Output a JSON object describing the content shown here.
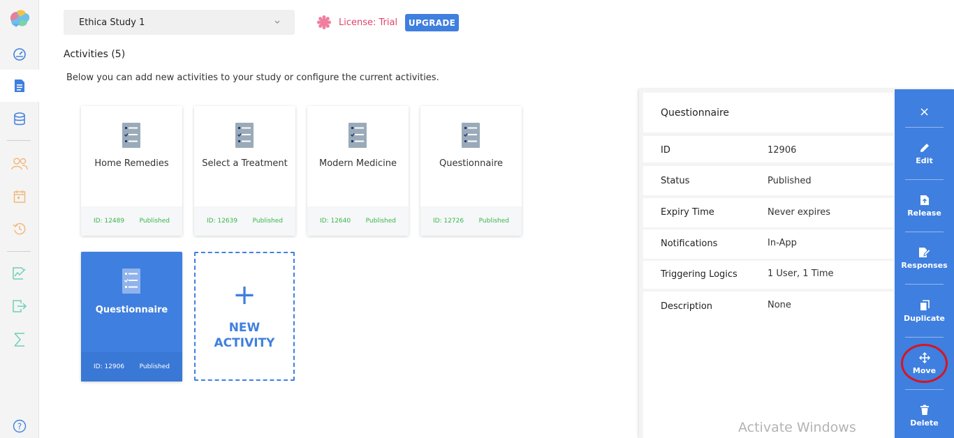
{
  "header": {
    "study_name": "Ethica Study 1",
    "license_text": "License: Trial",
    "upgrade_label": "UPGRADE"
  },
  "activities": {
    "title": "Activities (5)",
    "description": "Below you can add new activities to your study or configure the current activities.",
    "cards": [
      {
        "name": "Home Remedies",
        "id": "ID: 12489",
        "status": "Published"
      },
      {
        "name": "Select a Treatment",
        "id": "ID: 12639",
        "status": "Published"
      },
      {
        "name": "Modern Medicine",
        "id": "ID: 12640",
        "status": "Published"
      },
      {
        "name": "Questionnaire",
        "id": "ID: 12726",
        "status": "Published"
      },
      {
        "name": "Questionnaire",
        "id": "ID: 12906",
        "status": "Published",
        "selected": true
      }
    ],
    "new_activity": {
      "plus": "+",
      "line1": "NEW",
      "line2": "ACTIVITY"
    }
  },
  "detail": {
    "title": "Questionnaire",
    "rows": [
      {
        "key": "ID",
        "value": "12906"
      },
      {
        "key": "Status",
        "value": "Published"
      },
      {
        "key": "Expiry Time",
        "value": "Never expires"
      },
      {
        "key": "Notifications",
        "value": "In-App"
      },
      {
        "key": "Triggering Logics",
        "value": "1 User, 1 Time"
      },
      {
        "key": "Description",
        "value": "None"
      }
    ]
  },
  "actions": {
    "close": "×",
    "edit": "Edit",
    "release": "Release",
    "responses": "Responses",
    "duplicate": "Duplicate",
    "move": "Move",
    "delete": "Delete"
  },
  "watermark": "Activate Windows",
  "colors": {
    "accent": "#3f7fdf",
    "license": "#e0436b",
    "published": "#3ab54a",
    "sidebar_orange": "#f2b97a",
    "sidebar_teal": "#6fcfb8",
    "highlight_ring": "#d9141e"
  }
}
